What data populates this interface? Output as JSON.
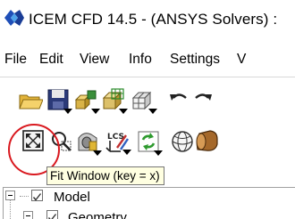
{
  "window": {
    "title": "ICEM CFD 14.5 - (ANSYS Solvers) :",
    "app_icon": "icem-cfd-logo-icon"
  },
  "menubar": {
    "items": [
      "File",
      "Edit",
      "View",
      "Info",
      "Settings",
      "V"
    ]
  },
  "toolbar": {
    "row1": [
      {
        "name": "open-icon"
      },
      {
        "name": "save-icon"
      },
      {
        "name": "geometry-mesh-icon"
      },
      {
        "name": "mesh-grid-icon"
      },
      {
        "name": "undo-icon"
      },
      {
        "name": "redo-icon"
      }
    ],
    "row2": [
      {
        "name": "fit-window-icon"
      },
      {
        "name": "zoom-box-icon"
      },
      {
        "name": "view-orientation-icon"
      },
      {
        "name": "local-coordinate-system-icon"
      },
      {
        "name": "refresh-icon"
      },
      {
        "name": "wireframe-sphere-icon"
      },
      {
        "name": "solid-cylinder-icon"
      }
    ]
  },
  "tooltip": {
    "text": "Fit Window (key = x)"
  },
  "highlight": {
    "color": "#d9191f"
  },
  "tree": {
    "items": [
      {
        "label": "Model"
      },
      {
        "label": "Geometry"
      }
    ]
  },
  "colors": {
    "tooltip_bg": "#ffffe1",
    "highlight": "#d9191f"
  }
}
